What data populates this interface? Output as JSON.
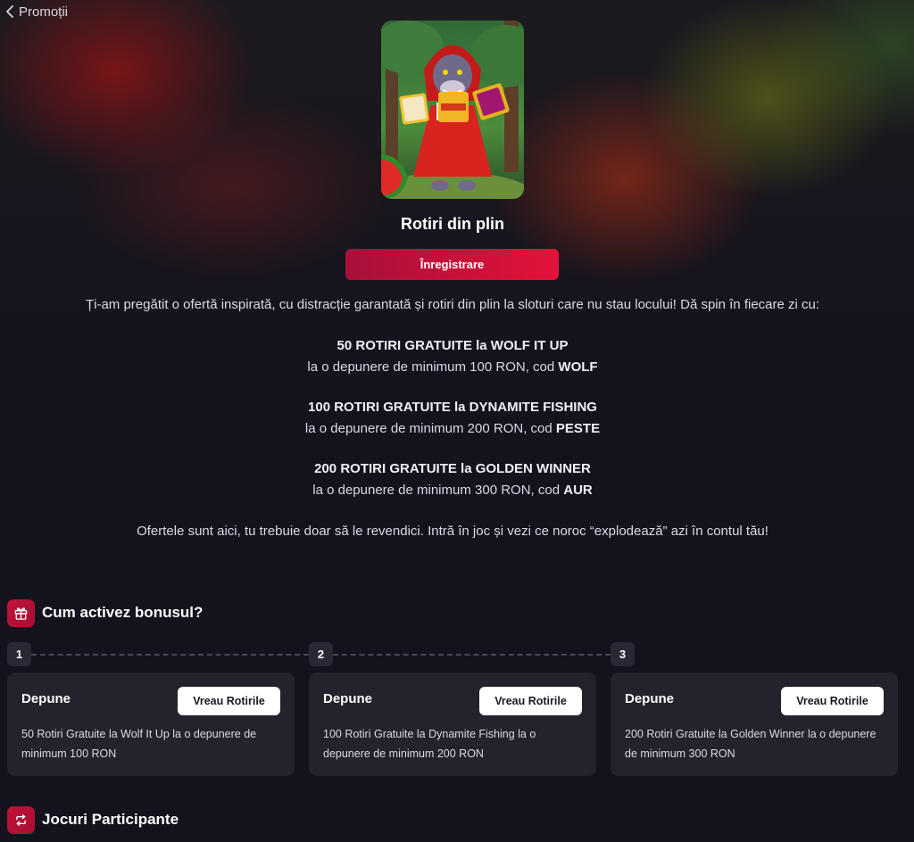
{
  "nav": {
    "back_label": "Promoții"
  },
  "promo": {
    "title": "Rotiri din plin",
    "register_label": "Înregistrare",
    "intro": "Ți-am pregătit o ofertă inspirată, cu distracție garantată și rotiri din plin la sloturi care nu stau locului! Dă spin în fiecare zi cu:",
    "offers": [
      {
        "headline": "50 ROTIRI GRATUITE la WOLF IT UP",
        "condition": "la o depunere de minimum 100 RON, cod ",
        "code": "WOLF"
      },
      {
        "headline": "100 ROTIRI GRATUITE la DYNAMITE FISHING",
        "condition": "la o depunere de minimum 200 RON, cod ",
        "code": "PESTE"
      },
      {
        "headline": "200 ROTIRI GRATUITE la GOLDEN WINNER",
        "condition": "la o depunere de minimum 300 RON, cod ",
        "code": "AUR"
      }
    ],
    "outro": "Ofertele sunt aici, tu trebuie doar să le revendici. Intră în joc și vezi ce noroc “explodează” azi în contul tău!"
  },
  "how_to": {
    "title": "Cum activez bonusul?",
    "icon": "gift-icon",
    "steps": [
      {
        "number": "1",
        "title": "Depune",
        "button": "Vreau Rotirile",
        "description": "50 Rotiri Gratuite la Wolf It Up la o depunere de minimum 100 RON"
      },
      {
        "number": "2",
        "title": "Depune",
        "button": "Vreau Rotirile",
        "description": "100 Rotiri Gratuite la Dynamite Fishing la o depunere de minimum 200 RON"
      },
      {
        "number": "3",
        "title": "Depune",
        "button": "Vreau Rotirile",
        "description": "200 Rotiri Gratuite la Golden Winner la o depunere de minimum 300 RON"
      }
    ]
  },
  "games": {
    "title": "Jocuri Participante",
    "icon": "repeat-icon"
  },
  "colors": {
    "accent": "#e4123a",
    "accent_dark": "#a8103a",
    "background": "#14121d",
    "card": "#24222c"
  }
}
